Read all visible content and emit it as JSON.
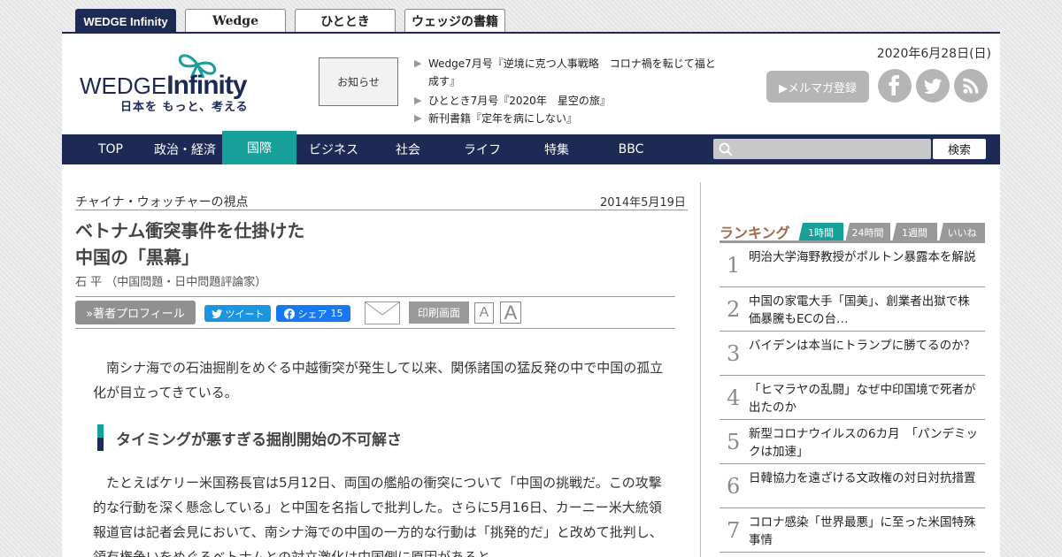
{
  "site_tabs": [
    "WEDGE Infinity",
    "Wedge",
    "ひととき",
    "ウェッジの書籍"
  ],
  "header": {
    "logo_word_1": "WEDGE",
    "logo_word_2": "Infinity",
    "logo_tagline": "日本を もっと、考える",
    "notice_label": "お知らせ",
    "news": [
      "Wedge7月号『逆境に克つ人事戦略　コロナ禍を転じて福と成す』",
      "ひととき7月号『2020年　星空の旅』",
      "新刊書籍『定年を病にしない』"
    ],
    "date": "2020年6月28日(日)",
    "mailmag_label": "▶メルマガ登録",
    "social_icons": [
      "facebook-icon",
      "twitter-icon",
      "rss-icon"
    ]
  },
  "nav": {
    "items": [
      "TOP",
      "政治・経済",
      "国際",
      "ビジネス",
      "社会",
      "ライフ",
      "特集",
      "BBC"
    ],
    "active": "国際",
    "search_placeholder": "",
    "search_button": "検索"
  },
  "article": {
    "series": "チャイナ・ウォッチャーの視点",
    "date": "2014年5月19日",
    "title_line1": "ベトナム衝突事件を仕掛けた",
    "title_line2": "中国の「黒幕」",
    "author": "石 平 （中国問題・日中問題評論家）",
    "profile_button": "»著者プロフィール",
    "tweet_label": "ツイート",
    "share_label": "シェア",
    "share_count": "15",
    "print_label": "印刷画面",
    "font_small": "A",
    "font_large": "A",
    "para1": "南シナ海での石油掘削をめぐる中越衝突が発生して以来、関係諸国の猛反発の中で中国の孤立化が目立ってきている。",
    "subheading": "タイミングが悪すぎる掘削開始の不可解さ",
    "para2": "たとえばケリー米国務長官は5月12日、両国の艦船の衝突について「中国の挑戦だ。この攻撃的な行動を深く懸念している」と中国を名指しで批判した。さらに5月16日、カーニー米大統領報道官は記者会見において、南シナ海での中国の一方的な行動は「挑発的だ」と改めて批判し、領有権争いをめぐるベトナムとの対立激化は中国側に原因があると"
  },
  "ranking": {
    "title": "ランキング",
    "tabs": [
      "1時間",
      "24時間",
      "1週間",
      "いいね"
    ],
    "active_tab": "1時間",
    "items": [
      {
        "rank": "1",
        "text": "明治大学海野教授がポルトン暴露本を解説"
      },
      {
        "rank": "2",
        "text": "中国の家電大手「国美」、創業者出獄で株価暴騰もECの台…"
      },
      {
        "rank": "3",
        "text": "バイデンは本当にトランプに勝てるのか？"
      },
      {
        "rank": "4",
        "text": "「ヒマラヤの乱闘」なぜ中印国境で死者が出たのか"
      },
      {
        "rank": "5",
        "text": "新型コロナウイルスの6カ月　「パンデミックは加速」"
      },
      {
        "rank": "6",
        "text": "日韓協力を遠ざける文政権の対日対抗措置"
      },
      {
        "rank": "7",
        "text": "コロナ感染「世界最悪」に至った米国特殊事情"
      }
    ]
  },
  "colors": {
    "navy": "#1d2a55",
    "teal": "#17a099",
    "gray_button": "#909090",
    "twitter_blue": "#1b95e0",
    "facebook_blue": "#1877f2"
  }
}
